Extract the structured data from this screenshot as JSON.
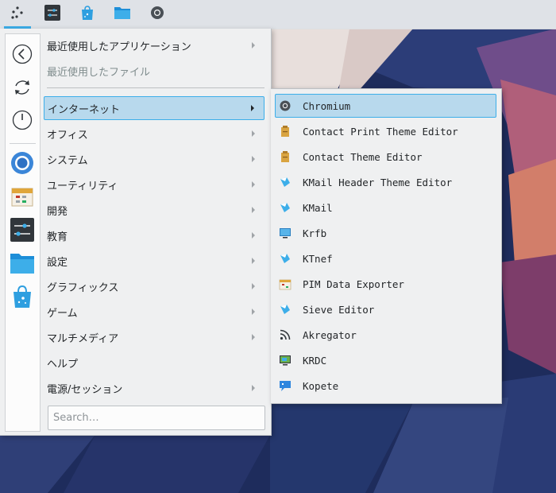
{
  "panel": {
    "buttons": [
      {
        "name": "application-launcher-button",
        "icon": "kde-launcher-icon"
      },
      {
        "name": "system-settings-button",
        "icon": "settings-sliders-icon"
      },
      {
        "name": "discover-store-button",
        "icon": "discover-bag-icon"
      },
      {
        "name": "dolphin-file-manager-button",
        "icon": "folder-icon"
      },
      {
        "name": "chromium-button",
        "icon": "chromium-icon"
      }
    ]
  },
  "favorites": [
    {
      "name": "back-button",
      "icon": "back-arrow-icon"
    },
    {
      "name": "reboot-button",
      "icon": "reload-icon"
    },
    {
      "name": "shutdown-button",
      "icon": "power-icon"
    },
    {
      "name": "fav-chromium",
      "icon": "chromium-icon"
    },
    {
      "name": "fav-pim-data-exporter",
      "icon": "calendar-icon"
    },
    {
      "name": "fav-system-settings",
      "icon": "settings-sliders-icon"
    },
    {
      "name": "fav-dolphin",
      "icon": "folder-icon"
    },
    {
      "name": "fav-discover",
      "icon": "discover-bag-icon"
    }
  ],
  "categories": {
    "recent_apps": "最近使用したアプリケーション",
    "recent_files": "最近使用したファイル",
    "items": [
      {
        "label": "インターネット",
        "arrow": true
      },
      {
        "label": "オフィス",
        "arrow": true
      },
      {
        "label": "システム",
        "arrow": true
      },
      {
        "label": "ユーティリティ",
        "arrow": true
      },
      {
        "label": "開発",
        "arrow": true
      },
      {
        "label": "教育",
        "arrow": true
      },
      {
        "label": "設定",
        "arrow": true
      },
      {
        "label": "グラフィックス",
        "arrow": true
      },
      {
        "label": "ゲーム",
        "arrow": true
      },
      {
        "label": "マルチメディア",
        "arrow": true
      },
      {
        "label": "ヘルプ",
        "arrow": false
      },
      {
        "label": "電源/セッション",
        "arrow": true
      }
    ]
  },
  "search": {
    "placeholder": "Search…",
    "value": ""
  },
  "submenu": {
    "items": [
      {
        "label": "Chromium",
        "icon": "chromium-icon"
      },
      {
        "label": "Contact Print Theme Editor",
        "icon": "theme-editor-icon"
      },
      {
        "label": "Contact Theme Editor",
        "icon": "theme-editor-icon"
      },
      {
        "label": "KMail Header Theme Editor",
        "icon": "kmail-icon"
      },
      {
        "label": "KMail",
        "icon": "kmail-icon"
      },
      {
        "label": "Krfb",
        "icon": "desktop-sharing-icon"
      },
      {
        "label": "KTnef",
        "icon": "kmail-icon"
      },
      {
        "label": "PIM Data Exporter",
        "icon": "calendar-icon"
      },
      {
        "label": "Sieve Editor",
        "icon": "kmail-icon"
      },
      {
        "label": "Akregator",
        "icon": "rss-feed-icon"
      },
      {
        "label": "KRDC",
        "icon": "remote-desktop-icon"
      },
      {
        "label": "Kopete",
        "icon": "chat-bubble-icon"
      }
    ]
  },
  "colors": {
    "accent": "#3daee9",
    "selection": "#b8d9ed",
    "menu_bg": "#eff0f1"
  }
}
